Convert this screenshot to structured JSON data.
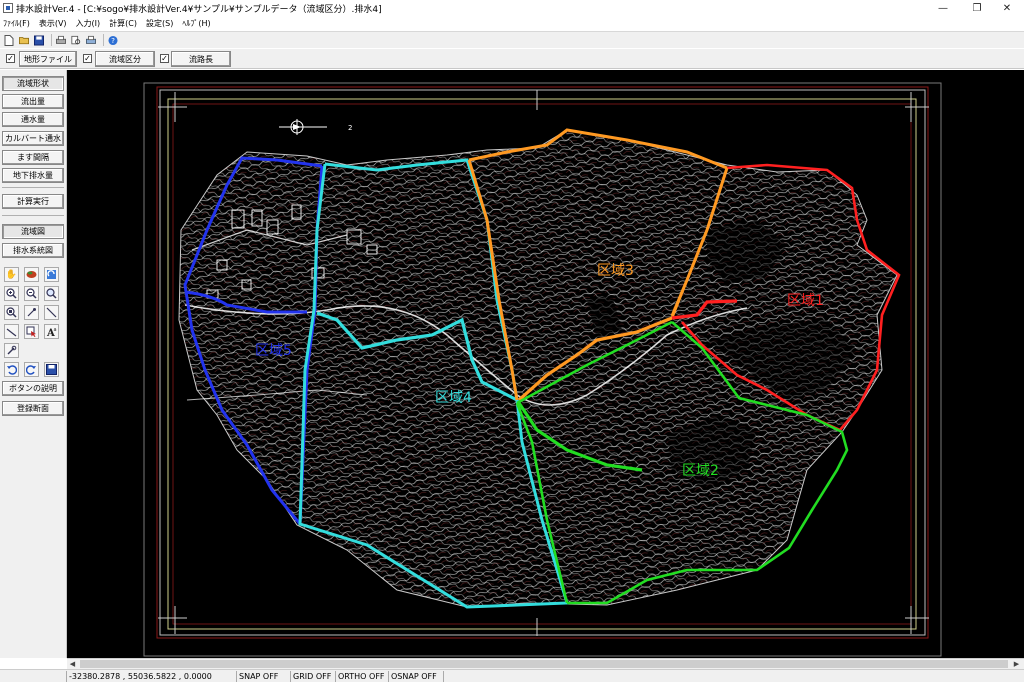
{
  "window": {
    "title": "排水設計Ver.4 - [C:¥sogo¥排水設計Ver.4¥サンプル¥サンプルデータ（流域区分）.排水4]",
    "minimize_icon": "minimize-icon",
    "maximize_icon": "maximize-icon",
    "close_icon": "close-icon"
  },
  "menu": [
    {
      "label": "ﾌｧｲﾙ(F)"
    },
    {
      "label": "表示(V)"
    },
    {
      "label": "入力(I)"
    },
    {
      "label": "計算(C)"
    },
    {
      "label": "設定(S)"
    },
    {
      "label": "ﾍﾙﾌﾟ(H)"
    }
  ],
  "layers": {
    "terrain_label": "地形ファイル",
    "basin_label": "流域区分",
    "flowlength_label": "流路長",
    "terrain_checked": true,
    "basin_checked": true,
    "flowlength_checked": true
  },
  "side": {
    "basin_shape": "流域形状",
    "runoff": "流出量",
    "flow_capacity": "通水量",
    "culvert_flow": "カルバート通水",
    "basin_spacing": "ます間隔",
    "underground_drain": "地下排水量",
    "calculate": "計算実行",
    "basin_map": "流域図",
    "drainage_map": "排水系統図",
    "button_help": "ボタンの説明",
    "register_section": "登録断面"
  },
  "map": {
    "north_label": "2",
    "zones": [
      {
        "label": "区域1",
        "color": "#ff2020"
      },
      {
        "label": "区域2",
        "color": "#22dd22"
      },
      {
        "label": "区域3",
        "color": "#ff9922"
      },
      {
        "label": "区域4",
        "color": "#33dddd"
      },
      {
        "label": "区域5",
        "color": "#2233ee"
      }
    ]
  },
  "status": {
    "coords": "-32380.2878 , 55036.5822 , 0.0000",
    "snap": "SNAP OFF",
    "grid": "GRID OFF",
    "ortho": "ORTHO OFF",
    "osnap": "OSNAP OFF"
  }
}
